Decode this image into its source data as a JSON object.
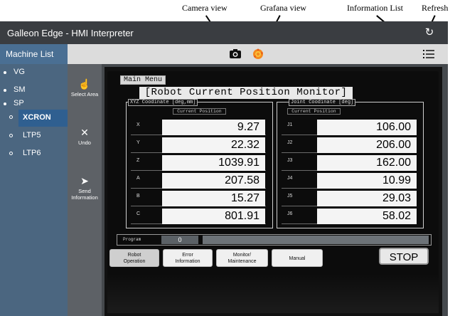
{
  "annotations": {
    "camera_view": "Camera view",
    "grafana_view": "Grafana view",
    "information_list": "Information List",
    "refresh": "Refresh"
  },
  "app": {
    "title": "Galleon Edge - HMI Interpreter",
    "machine_list_label": "Machine List"
  },
  "tree": [
    {
      "label": "VG",
      "level": 0
    },
    {
      "label": "SM",
      "level": 0
    },
    {
      "label": "SP",
      "level": 0
    },
    {
      "label": "XCRON",
      "level": 1,
      "selected": true
    },
    {
      "label": "LTP5",
      "level": 1
    },
    {
      "label": "LTP6",
      "level": 1
    }
  ],
  "tools": {
    "select_area": "Select Area",
    "undo": "Undo",
    "send_line1": "Send",
    "send_line2": "Information"
  },
  "hmi": {
    "main_menu": "Main Menu",
    "title": "[Robot Current Position Monitor]",
    "left_panel": {
      "header": "XYZ Coodinate [deg,mm]",
      "sub": "Current Position",
      "rows": [
        {
          "axis": "X",
          "value": "9.27"
        },
        {
          "axis": "Y",
          "value": "22.32"
        },
        {
          "axis": "Z",
          "value": "1039.91"
        },
        {
          "axis": "A",
          "value": "207.58"
        },
        {
          "axis": "B",
          "value": "15.27"
        },
        {
          "axis": "C",
          "value": "801.91"
        }
      ]
    },
    "right_panel": {
      "header": "Joint Coodinate [deg]",
      "sub": "Current Position",
      "rows": [
        {
          "axis": "J1",
          "value": "106.00"
        },
        {
          "axis": "J2",
          "value": "206.00"
        },
        {
          "axis": "J3",
          "value": "162.00"
        },
        {
          "axis": "J4",
          "value": "10.99"
        },
        {
          "axis": "J5",
          "value": "29.03"
        },
        {
          "axis": "J6",
          "value": "58.02"
        }
      ]
    },
    "program_label": "Program",
    "program_value": "0",
    "buttons": {
      "robot_operation_1": "Robot",
      "robot_operation_2": "Operation",
      "error_information_1": "Error",
      "error_information_2": "Information",
      "monitor_1": "Monitor/",
      "monitor_2": "Maintenance",
      "manual": "Manual",
      "stop": "STOP"
    }
  },
  "colors": {
    "title_bar": "#3a3d41",
    "machine_tab": "#4a6f93",
    "sidebar": "#4b6680",
    "selected_item": "#2f5f90",
    "toolbar": "#dcdcdc"
  },
  "icons": {
    "camera": "camera-icon",
    "grafana": "grafana-icon",
    "list": "list-icon",
    "refresh": "refresh-icon",
    "hand": "hand-pointer-icon",
    "undo": "close-icon",
    "send": "send-icon"
  }
}
